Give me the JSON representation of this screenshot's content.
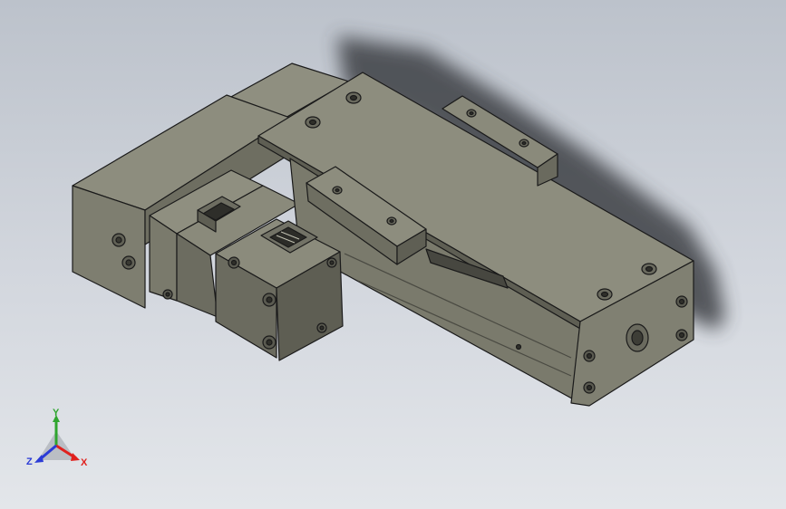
{
  "viewport": {
    "background_top": "#bcc2cb",
    "background_bottom": "#e3e6ea",
    "model_color": "#8a8a7b",
    "model_edge_color": "#1a1a1a"
  },
  "triad": {
    "x_label": "X",
    "y_label": "Y",
    "z_label": "Z",
    "x_color": "#e0211e",
    "y_color": "#2fa52f",
    "z_color": "#2b3bd6"
  }
}
